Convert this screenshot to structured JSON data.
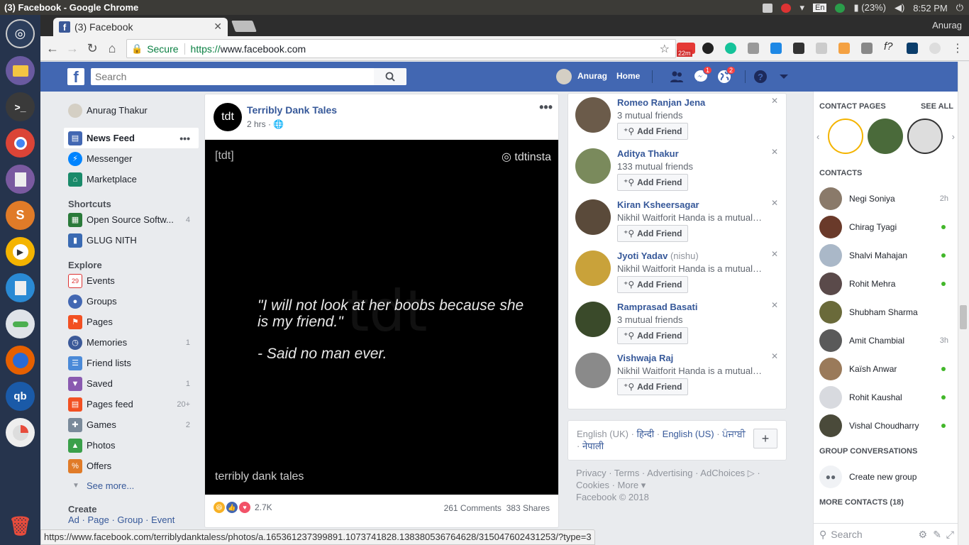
{
  "os": {
    "window_title": "(3) Facebook - Google Chrome",
    "tray": {
      "keyboard": "En",
      "battery": "(23%)",
      "clock": "8:52 PM"
    }
  },
  "browser": {
    "tab_title": "(3) Facebook",
    "profile": "Anurag",
    "secure_label": "Secure",
    "url_proto": "https://",
    "url_host": "www.facebook.com",
    "ext_badge": "22m",
    "status_url": "https://www.facebook.com/terriblydanktaless/photos/a.165361237399891.1073741828.138380536764628/315047602431253/?type=3"
  },
  "fb_header": {
    "search_placeholder": "Search",
    "user": "Anurag",
    "home": "Home",
    "messages_badge": "1",
    "notifications_badge": "2"
  },
  "leftnav": {
    "profile_name": "Anurag Thakur",
    "main": [
      {
        "label": "News Feed",
        "count": ""
      },
      {
        "label": "Messenger",
        "count": ""
      },
      {
        "label": "Marketplace",
        "count": ""
      }
    ],
    "shortcuts_head": "Shortcuts",
    "shortcuts": [
      {
        "label": "Open Source Softw...",
        "count": "4"
      },
      {
        "label": "GLUG NITH",
        "count": ""
      }
    ],
    "explore_head": "Explore",
    "explore": [
      {
        "label": "Events",
        "count": ""
      },
      {
        "label": "Groups",
        "count": ""
      },
      {
        "label": "Pages",
        "count": ""
      },
      {
        "label": "Memories",
        "count": "1"
      },
      {
        "label": "Friend lists",
        "count": ""
      },
      {
        "label": "Saved",
        "count": "1"
      },
      {
        "label": "Pages feed",
        "count": "20+"
      },
      {
        "label": "Games",
        "count": "2"
      },
      {
        "label": "Photos",
        "count": ""
      },
      {
        "label": "Offers",
        "count": ""
      }
    ],
    "see_more": "See more...",
    "create_head": "Create",
    "create_links": [
      "Ad",
      "Page",
      "Group",
      "Event"
    ]
  },
  "post": {
    "page_name": "Terribly Dank Tales",
    "avatar_text": "tdt",
    "time": "2 hrs · ",
    "image": {
      "brand": "[tdt]",
      "insta": "tdtinsta",
      "watermark": "tdt",
      "quote": "\"I will not look at her boobs because she is my friend.\"",
      "attribution": "- Said no man ever.",
      "footer": "terribly dank tales"
    },
    "reactions_count": "2.7K",
    "comments": "261 Comments",
    "shares": "383 Shares"
  },
  "pymk": {
    "add_label": "Add Friend",
    "people": [
      {
        "name": "Romeo Ranjan Jena",
        "nick": "",
        "mutual": "3 mutual friends",
        "color": "#6b5b4a"
      },
      {
        "name": "Aditya Thakur",
        "nick": "",
        "mutual": "133 mutual friends",
        "color": "#7a8a5c"
      },
      {
        "name": "Kiran Ksheersagar",
        "nick": "",
        "mutual": "Nikhil Waitforit Handa is a mutual friend.",
        "color": "#5a4a3a"
      },
      {
        "name": "Jyoti Yadav",
        "nick": "(nishu)",
        "mutual": "Nikhil Waitforit Handa is a mutual friend.",
        "color": "#c9a23a"
      },
      {
        "name": "Ramprasad Basati",
        "nick": "",
        "mutual": "3 mutual friends",
        "color": "#3a4a2a"
      },
      {
        "name": "Vishwaja Raj",
        "nick": "",
        "mutual": "Nikhil Waitforit Handa is a mutual friend.",
        "color": "#8a8a8a"
      }
    ]
  },
  "lang": {
    "current": "English (UK)",
    "options": [
      "हिन्दी",
      "English (US)",
      "ਪੰਜਾਬੀ",
      "नेपाली"
    ]
  },
  "footer_links": {
    "line1": "Privacy · Terms · Advertising · AdChoices ▷ ·",
    "line2": "Cookies · More ▾",
    "copyright": "Facebook © 2018"
  },
  "chat": {
    "contact_pages": "CONTACT PAGES",
    "see_all": "SEE ALL",
    "contacts_head": "CONTACTS",
    "contacts": [
      {
        "name": "Negi Soniya",
        "time": "2h",
        "online": false,
        "color": "#8a7a6a"
      },
      {
        "name": "Chirag Tyagi",
        "time": "",
        "online": true,
        "color": "#6a3a2a"
      },
      {
        "name": "Shalvi Mahajan",
        "time": "",
        "online": true,
        "color": "#aab8c8"
      },
      {
        "name": "Rohit Mehra",
        "time": "",
        "online": true,
        "color": "#5a4a4a"
      },
      {
        "name": "Shubham Sharma",
        "time": "",
        "online": false,
        "color": "#6a6a3a"
      },
      {
        "name": "Amit Chambial",
        "time": "3h",
        "online": false,
        "color": "#5a5a5a"
      },
      {
        "name": "Kaïsh Anwar",
        "time": "",
        "online": true,
        "color": "#9a7a5a"
      },
      {
        "name": "Rohit Kaushal",
        "time": "",
        "online": true,
        "color": "#d8dadf"
      },
      {
        "name": "Vishal Choudharry",
        "time": "",
        "online": true,
        "color": "#4a4a3a"
      }
    ],
    "group_head": "GROUP CONVERSATIONS",
    "create_group": "Create new group",
    "more_head": "MORE CONTACTS (18)",
    "search_placeholder": "Search"
  }
}
